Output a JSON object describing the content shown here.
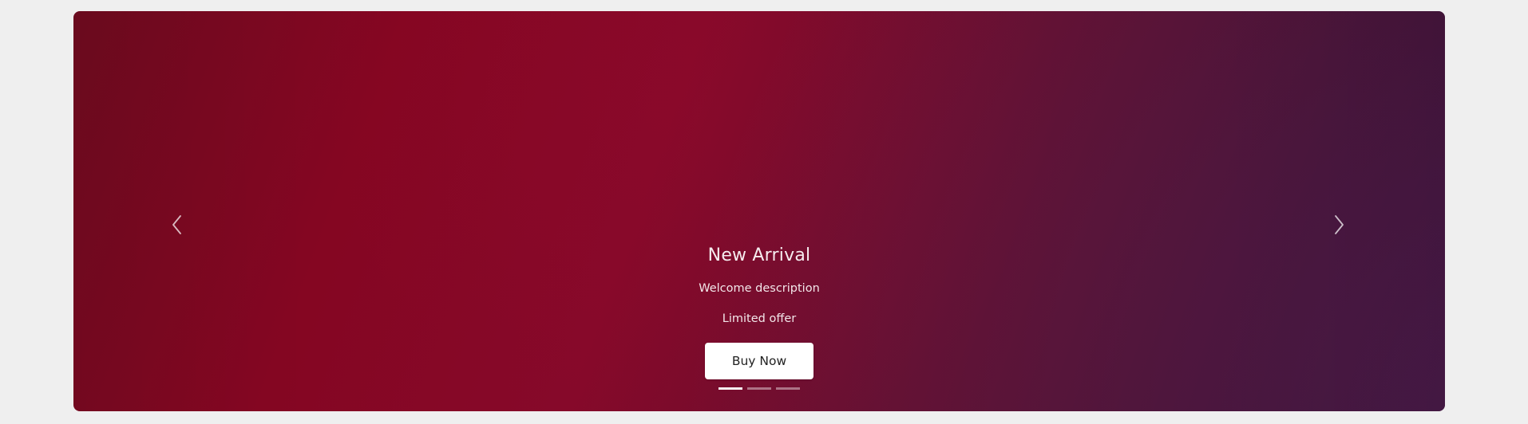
{
  "carousel": {
    "slide": {
      "title": "New Arrival",
      "description": "Welcome description",
      "offer": "Limited offer",
      "button_label": "Buy Now"
    },
    "arrows": {
      "left_icon": "chevron-left-icon",
      "right_icon": "chevron-right-icon"
    },
    "indicators": [
      {
        "active": true
      },
      {
        "active": false
      },
      {
        "active": false
      }
    ]
  },
  "colors": {
    "page_background": "#efefef",
    "slide_red": "#850622",
    "slide_purple": "#4c1b4e",
    "text_light": "#f3e7ea",
    "button_background": "#ffffff"
  }
}
